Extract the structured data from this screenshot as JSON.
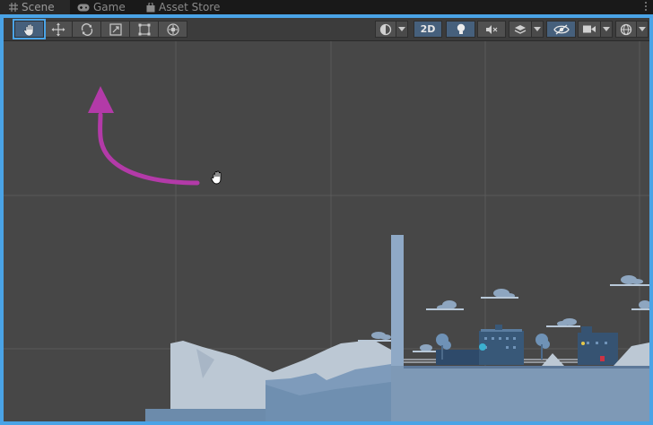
{
  "tabs": [
    {
      "label": "Scene",
      "icon": "grid-icon",
      "active": true
    },
    {
      "label": "Game",
      "icon": "gamepad-icon",
      "active": false
    },
    {
      "label": "Asset Store",
      "icon": "bag-icon",
      "active": false
    }
  ],
  "toolbar": {
    "tools": [
      "hand-tool",
      "move-tool",
      "rotate-tool",
      "scale-tool",
      "rect-tool",
      "transform-tool"
    ],
    "active_tool": "hand-tool",
    "mode_2d_label": "2D"
  },
  "colors": {
    "focus_border": "#4aa3e6",
    "active_button": "#46607c",
    "annotation_arrow": "#b33aa8",
    "scene_background": "#474747",
    "scenery_blue": "#7e99b6"
  }
}
